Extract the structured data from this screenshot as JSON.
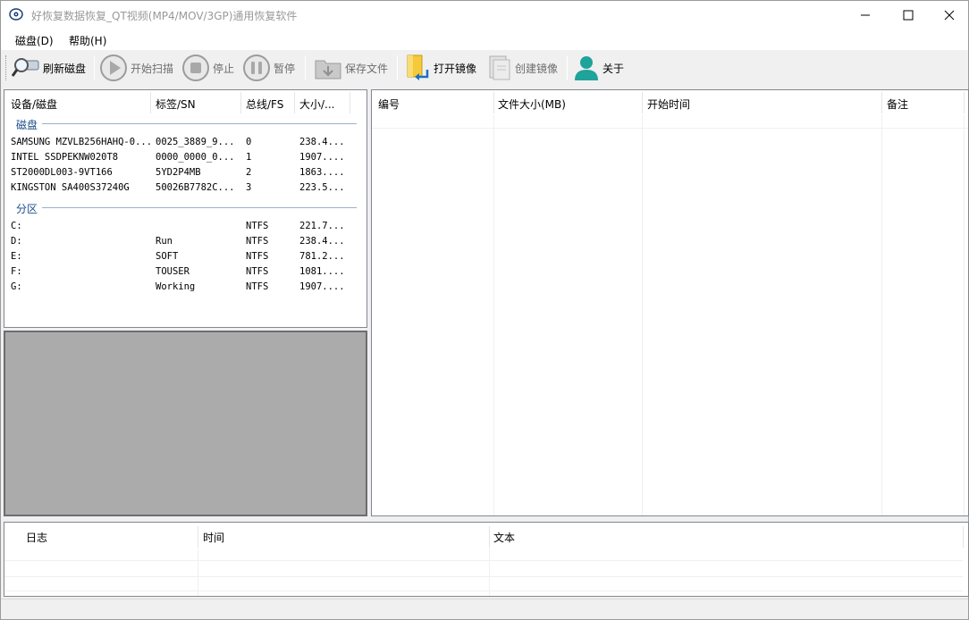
{
  "window": {
    "title": "好恢复数据恢复_QT视频(MP4/MOV/3GP)通用恢复软件"
  },
  "menu": {
    "disk": "磁盘(D)",
    "help": "帮助(H)"
  },
  "toolbar": {
    "refresh": "刷新磁盘",
    "start_scan": "开始扫描",
    "stop": "停止",
    "pause": "暂停",
    "save_file": "保存文件",
    "open_image": "打开镜像",
    "create_image": "创建镜像",
    "about": "关于"
  },
  "disk_panel": {
    "columns": [
      "设备/磁盘",
      "标签/SN",
      "总线/FS",
      "大小/..."
    ],
    "group_disks": "磁盘",
    "disks": [
      [
        "SAMSUNG MZVLB256HAHQ-0...",
        "0025_3889_9...",
        "0",
        "238.4..."
      ],
      [
        "INTEL SSDPEKNW020T8",
        "0000_0000_0...",
        "1",
        "1907...."
      ],
      [
        "ST2000DL003-9VT166",
        "5YD2P4MB",
        "2",
        "1863...."
      ],
      [
        "KINGSTON SA400S37240G",
        "50026B7782C...",
        "3",
        "223.5..."
      ]
    ],
    "group_partitions": "分区",
    "partitions": [
      [
        "C:",
        "",
        "NTFS",
        "221.7..."
      ],
      [
        "D:",
        "Run",
        "NTFS",
        "238.4..."
      ],
      [
        "E:",
        "SOFT",
        "NTFS",
        "781.2..."
      ],
      [
        "F:",
        "TOUSER",
        "NTFS",
        "1081...."
      ],
      [
        "G:",
        "Working",
        "NTFS",
        "1907...."
      ]
    ]
  },
  "file_panel": {
    "columns": [
      "编号",
      "文件大小(MB)",
      "开始时间",
      "备注"
    ]
  },
  "log_panel": {
    "columns": [
      "日志",
      "时间",
      "文本"
    ]
  },
  "colors": {
    "accent": "#1e4d8b",
    "preview_bg": "#ababab",
    "toolbar_bg": "#f0f0f0"
  }
}
